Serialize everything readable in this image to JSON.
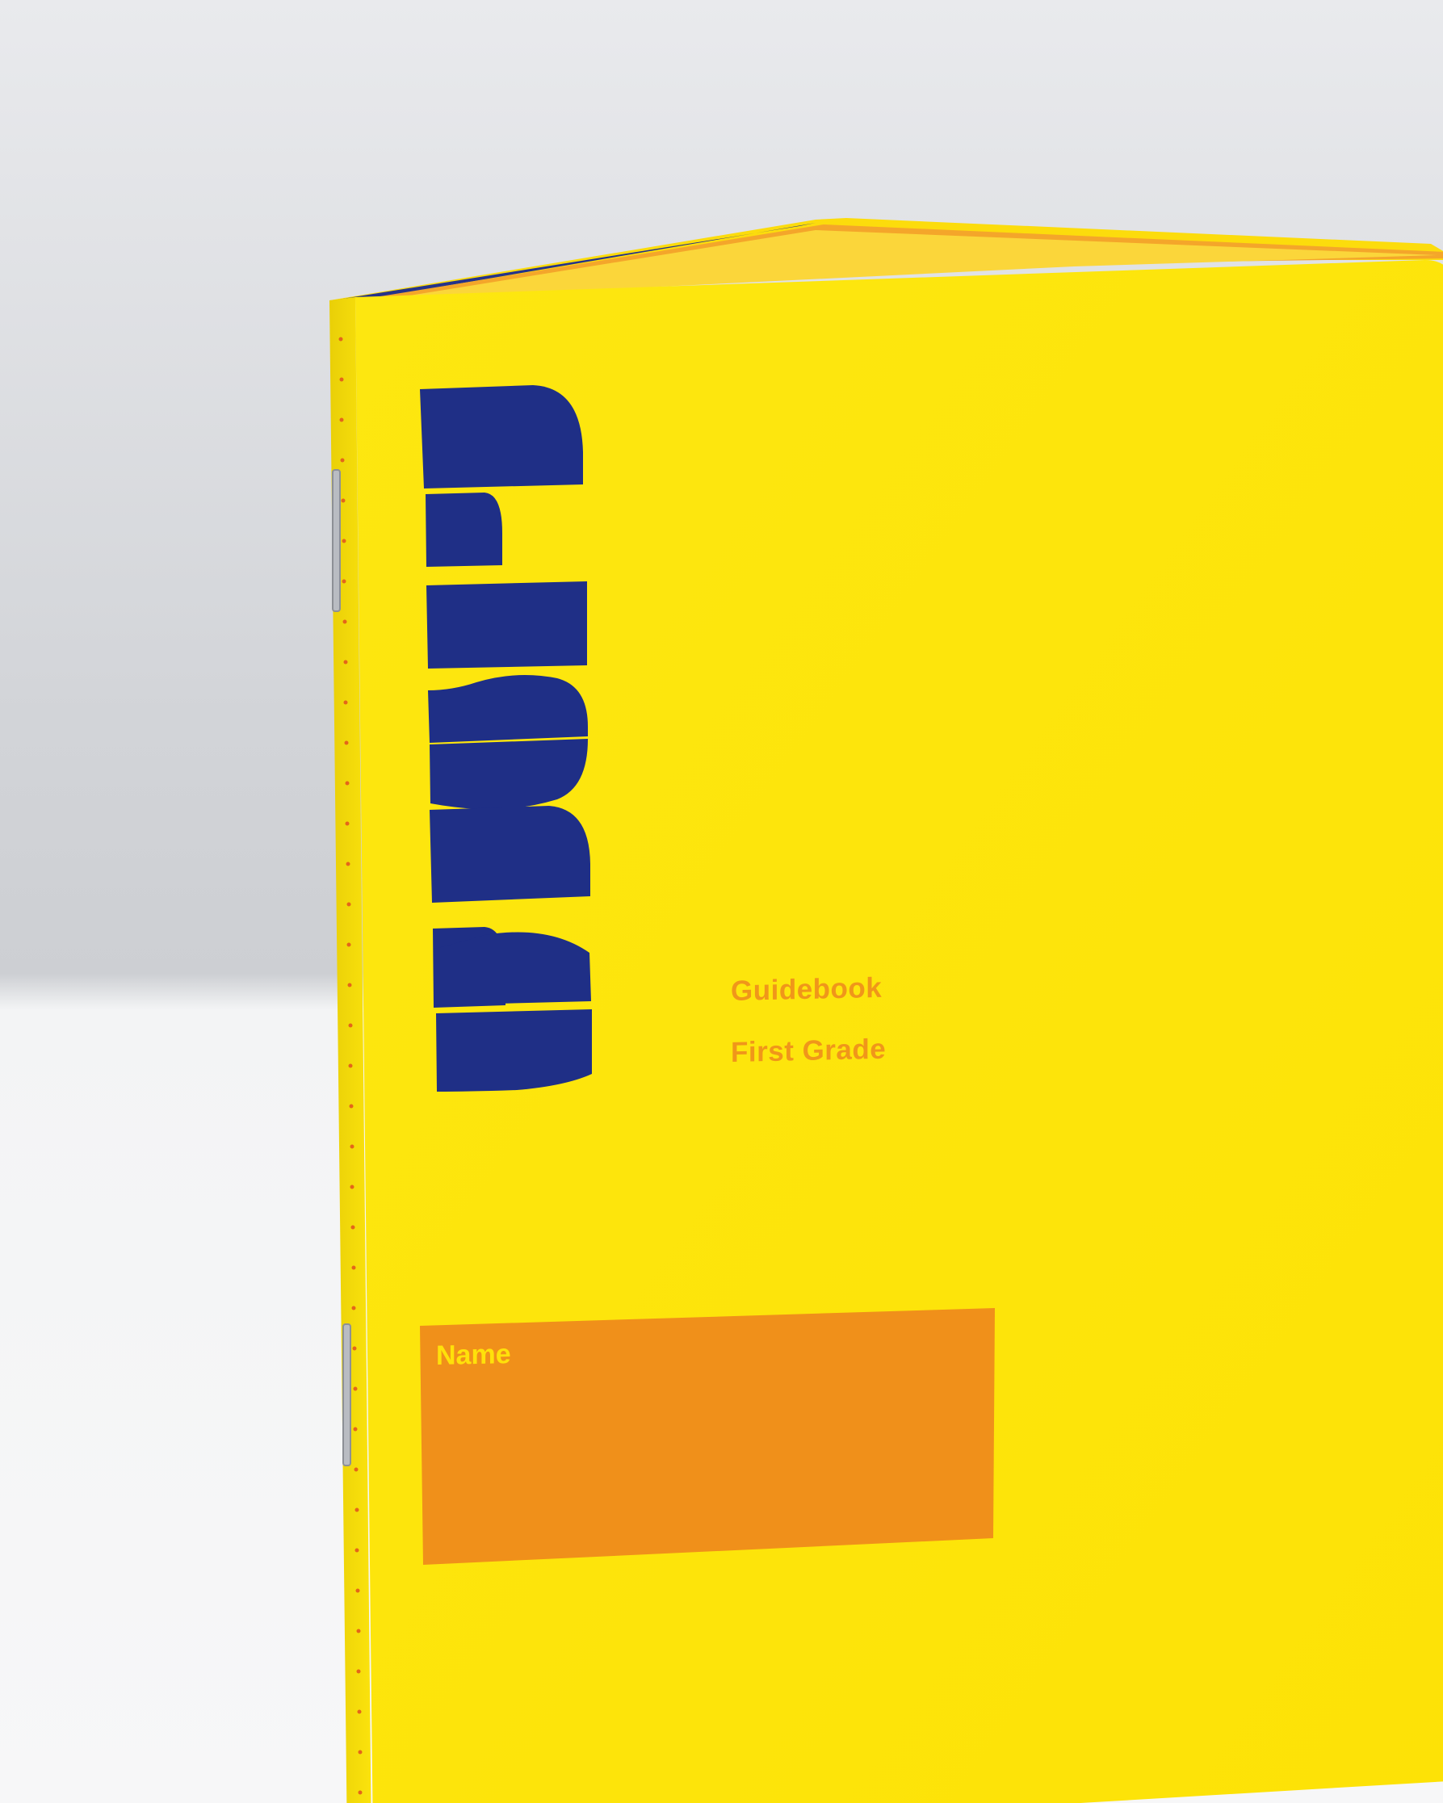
{
  "booklet": {
    "title": "Guidebook",
    "grade": "First Grade",
    "name_label": "Name",
    "logo_description": "Die-cut geometric letter shapes revealing blue pages"
  },
  "colors": {
    "cover_yellow": "#fde60a",
    "name_box_orange": "#f0901a",
    "text_orange": "#f0961a",
    "diecut_blue": "#1f2f86",
    "page_edge_orange": "#f6a020"
  }
}
